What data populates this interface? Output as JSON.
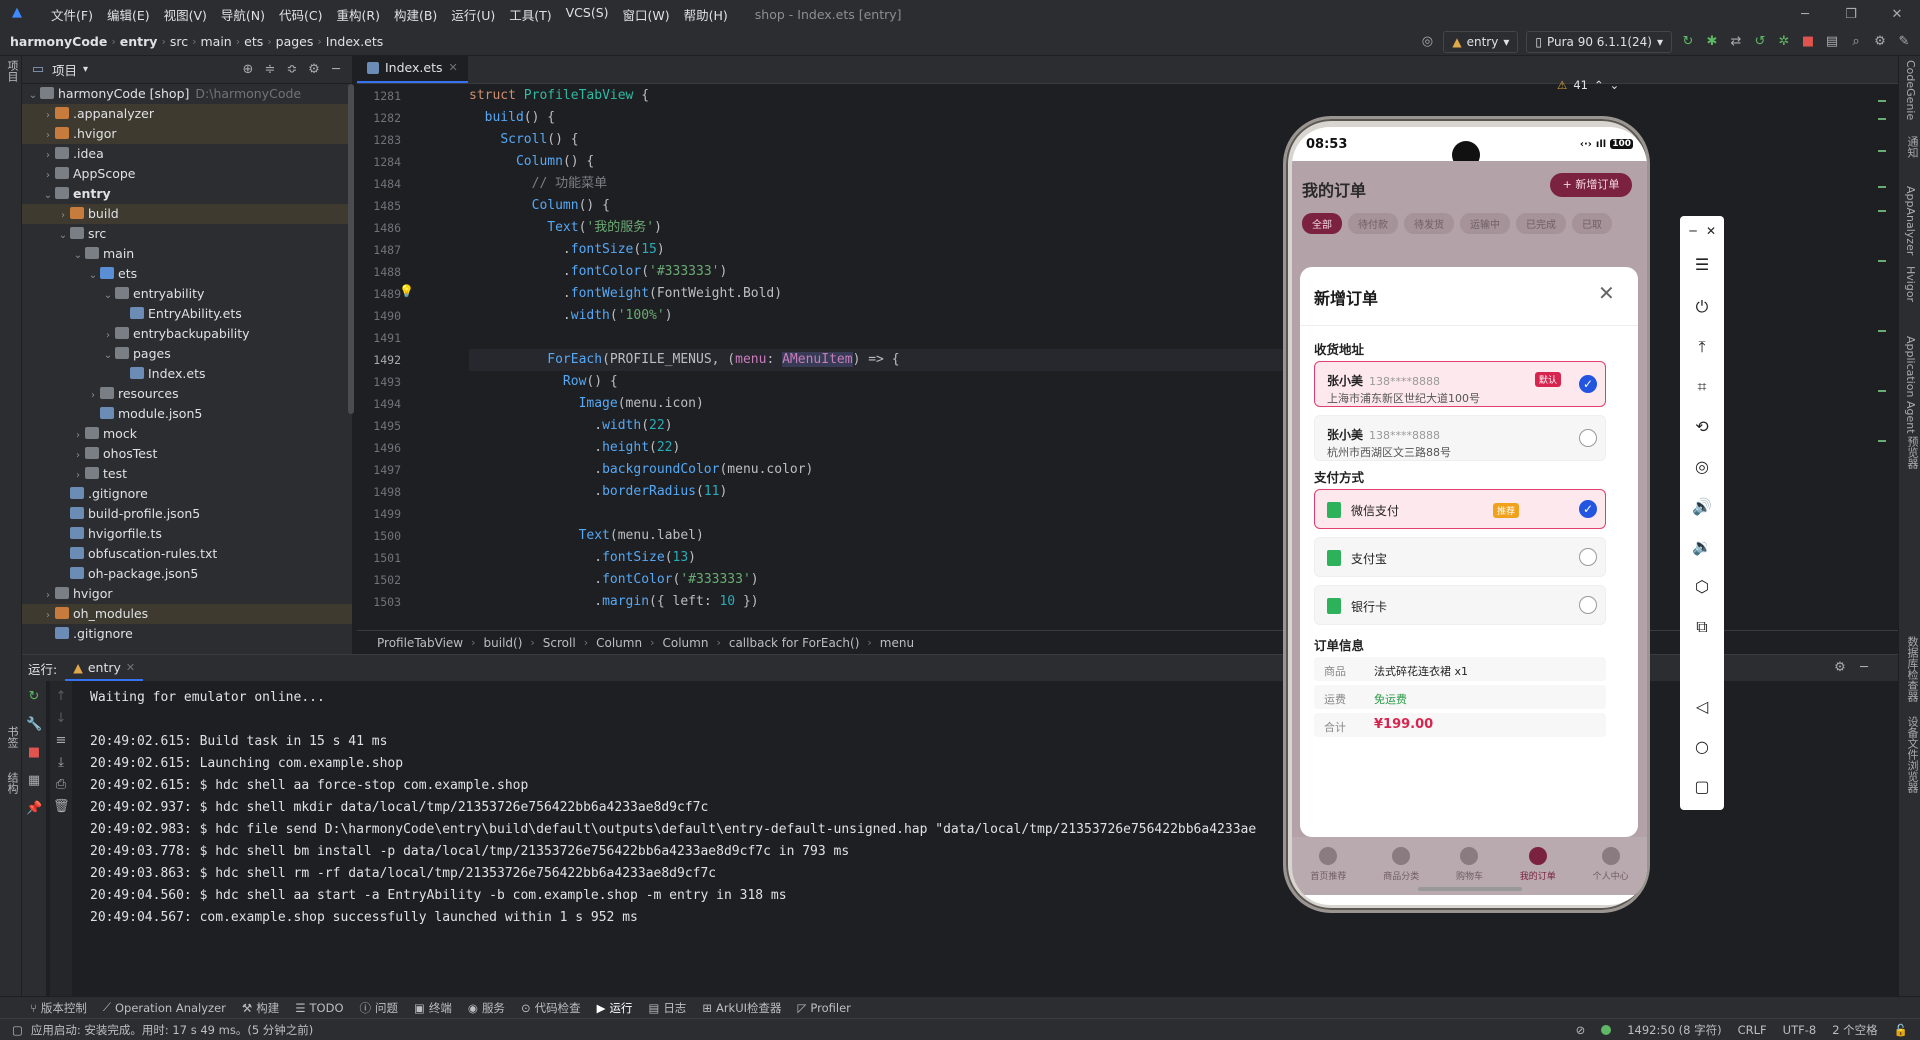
{
  "menubar": {
    "items": [
      "文件(F)",
      "编辑(E)",
      "视图(V)",
      "导航(N)",
      "代码(C)",
      "重构(R)",
      "构建(B)",
      "运行(U)",
      "工具(T)",
      "VCS(S)",
      "窗口(W)",
      "帮助(H)"
    ],
    "window_title": "shop - Index.ets [entry]"
  },
  "navbar": {
    "crumbs": [
      "harmonyCode",
      "entry",
      "src",
      "main",
      "ets",
      "pages",
      "Index.ets"
    ],
    "run_config": "entry",
    "device": "Pura 90 6.1.1(24)"
  },
  "left_strip": {
    "tab_project": "项目",
    "tab_bookmarks": "书签",
    "tab_structure": "结构"
  },
  "right_strip": {
    "tabs": [
      "CodeGenie",
      "通知",
      "AppAnalyzer",
      "Hvigor",
      "Application Agent",
      "预览器",
      "数据库检查器",
      "设备文件浏览器"
    ]
  },
  "project": {
    "title": "项目",
    "rows": [
      {
        "label": "harmonyCode [shop]",
        "hint": "D:\\harmonyCode",
        "indent": 0,
        "open": true,
        "kind": "root"
      },
      {
        "label": ".appanalyzer",
        "indent": 1,
        "open": false,
        "kind": "folder-o",
        "hl": true
      },
      {
        "label": ".hvigor",
        "indent": 1,
        "open": false,
        "kind": "folder-o",
        "hl": true
      },
      {
        "label": ".idea",
        "indent": 1,
        "open": false,
        "kind": "folder"
      },
      {
        "label": "AppScope",
        "indent": 1,
        "open": false,
        "kind": "folder"
      },
      {
        "label": "entry",
        "indent": 1,
        "open": true,
        "kind": "folder",
        "bold": true
      },
      {
        "label": "build",
        "indent": 2,
        "open": false,
        "kind": "folder-o",
        "hl": true
      },
      {
        "label": "src",
        "indent": 2,
        "open": true,
        "kind": "folder"
      },
      {
        "label": "main",
        "indent": 3,
        "open": true,
        "kind": "folder"
      },
      {
        "label": "ets",
        "indent": 4,
        "open": true,
        "kind": "folder-b"
      },
      {
        "label": "entryability",
        "indent": 5,
        "open": true,
        "kind": "folder"
      },
      {
        "label": "EntryAbility.ets",
        "indent": 6,
        "kind": "file"
      },
      {
        "label": "entrybackupability",
        "indent": 5,
        "open": false,
        "kind": "folder"
      },
      {
        "label": "pages",
        "indent": 5,
        "open": true,
        "kind": "folder"
      },
      {
        "label": "Index.ets",
        "indent": 6,
        "kind": "file"
      },
      {
        "label": "resources",
        "indent": 4,
        "open": false,
        "kind": "folder"
      },
      {
        "label": "module.json5",
        "indent": 4,
        "kind": "file"
      },
      {
        "label": "mock",
        "indent": 3,
        "open": false,
        "kind": "folder"
      },
      {
        "label": "ohosTest",
        "indent": 3,
        "open": false,
        "kind": "folder"
      },
      {
        "label": "test",
        "indent": 3,
        "open": false,
        "kind": "folder"
      },
      {
        "label": ".gitignore",
        "indent": 2,
        "kind": "file"
      },
      {
        "label": "build-profile.json5",
        "indent": 2,
        "kind": "file"
      },
      {
        "label": "hvigorfile.ts",
        "indent": 2,
        "kind": "file"
      },
      {
        "label": "obfuscation-rules.txt",
        "indent": 2,
        "kind": "file"
      },
      {
        "label": "oh-package.json5",
        "indent": 2,
        "kind": "file"
      },
      {
        "label": "hvigor",
        "indent": 1,
        "open": false,
        "kind": "folder"
      },
      {
        "label": "oh_modules",
        "indent": 1,
        "open": false,
        "kind": "folder-o",
        "hl": true
      },
      {
        "label": ".gitignore",
        "indent": 1,
        "kind": "file"
      }
    ]
  },
  "editor": {
    "tab": "Index.ets",
    "warnings": "41",
    "line_numbers": [
      "1281",
      "1282",
      "1283",
      "1284",
      "1484",
      "1485",
      "1486",
      "1487",
      "1488",
      "1489",
      "1490",
      "1491",
      "1492",
      "1493",
      "1494",
      "1495",
      "1496",
      "1497",
      "1498",
      "1499",
      "1500",
      "1501",
      "1502",
      "1503"
    ],
    "current_line": "1492",
    "breadcrumb": [
      "ProfileTabView",
      "build()",
      "Scroll",
      "Column",
      "Column",
      "callback for ForEach()",
      "menu"
    ]
  },
  "run": {
    "label": "运行:",
    "tab": "entry",
    "lines": [
      "Waiting for emulator online...",
      "",
      "20:49:02.615: Build task in 15 s 41 ms",
      "20:49:02.615: Launching com.example.shop",
      "20:49:02.615: $ hdc shell aa force-stop com.example.shop",
      "20:49:02.937: $ hdc shell mkdir data/local/tmp/21353726e756422bb6a4233ae8d9cf7c",
      "20:49:02.983: $ hdc file send D:\\harmonyCode\\entry\\build\\default\\outputs\\default\\entry-default-unsigned.hap \"data/local/tmp/21353726e756422bb6a4233ae",
      "20:49:03.778: $ hdc shell bm install -p data/local/tmp/21353726e756422bb6a4233ae8d9cf7c in 793 ms",
      "20:49:03.863: $ hdc shell rm -rf data/local/tmp/21353726e756422bb6a4233ae8d9cf7c",
      "20:49:04.560: $ hdc shell aa start -a EntryAbility -b com.example.shop -m entry in 318 ms",
      "20:49:04.567: com.example.shop successfully launched within 1 s 952 ms"
    ]
  },
  "bottom_tools": [
    {
      "label": "版本控制",
      "icon": "branch-icon"
    },
    {
      "label": "Operation Analyzer",
      "icon": "chart-icon"
    },
    {
      "label": "构建",
      "icon": "hammer-icon"
    },
    {
      "label": "TODO",
      "icon": "list-icon"
    },
    {
      "label": "问题",
      "icon": "info-icon"
    },
    {
      "label": "终端",
      "icon": "terminal-icon"
    },
    {
      "label": "服务",
      "icon": "services-icon"
    },
    {
      "label": "代码检查",
      "icon": "inspect-icon"
    },
    {
      "label": "运行",
      "icon": "run-icon",
      "active": true
    },
    {
      "label": "日志",
      "icon": "log-icon"
    },
    {
      "label": "ArkUI检查器",
      "icon": "arkui-icon"
    },
    {
      "label": "Profiler",
      "icon": "profiler-icon"
    }
  ],
  "status": {
    "message": "应用启动: 安装完成。用时: 17 s 49 ms。(5 分钟之前)",
    "position": "1492:50 (8 字符)",
    "line_ending": "CRLF",
    "encoding": "UTF-8",
    "indent": "2 个空格"
  },
  "phone": {
    "time": "08:53",
    "battery": "100",
    "page_title": "我的订单",
    "new_order_btn": "+ 新增订单",
    "chips": [
      "全部",
      "待付款",
      "待发货",
      "运输中",
      "已完成",
      "已取"
    ],
    "modal": {
      "title": "新增订单",
      "addr_section": "收货地址",
      "addresses": [
        {
          "name": "张小美",
          "phone": "138****8888",
          "addr": "上海市浦东新区世纪大道100号",
          "badge": "默认",
          "selected": true
        },
        {
          "name": "张小美",
          "phone": "138****8888",
          "addr": "杭州市西湖区文三路88号",
          "selected": false
        }
      ],
      "pay_section": "支付方式",
      "payments": [
        {
          "label": "微信支付",
          "badge": "推荐",
          "selected": true
        },
        {
          "label": "支付宝",
          "selected": false
        },
        {
          "label": "银行卡",
          "selected": false
        }
      ],
      "info_section": "订单信息",
      "info": [
        {
          "k": "商品",
          "v": "法式碎花连衣裙 x1"
        },
        {
          "k": "运费",
          "v": "免运费"
        },
        {
          "k": "合计",
          "v": "¥199.00"
        }
      ]
    },
    "tabs": [
      "首页推荐",
      "商品分类",
      "购物车",
      "我的订单",
      "个人中心"
    ],
    "active_tab": 3
  }
}
